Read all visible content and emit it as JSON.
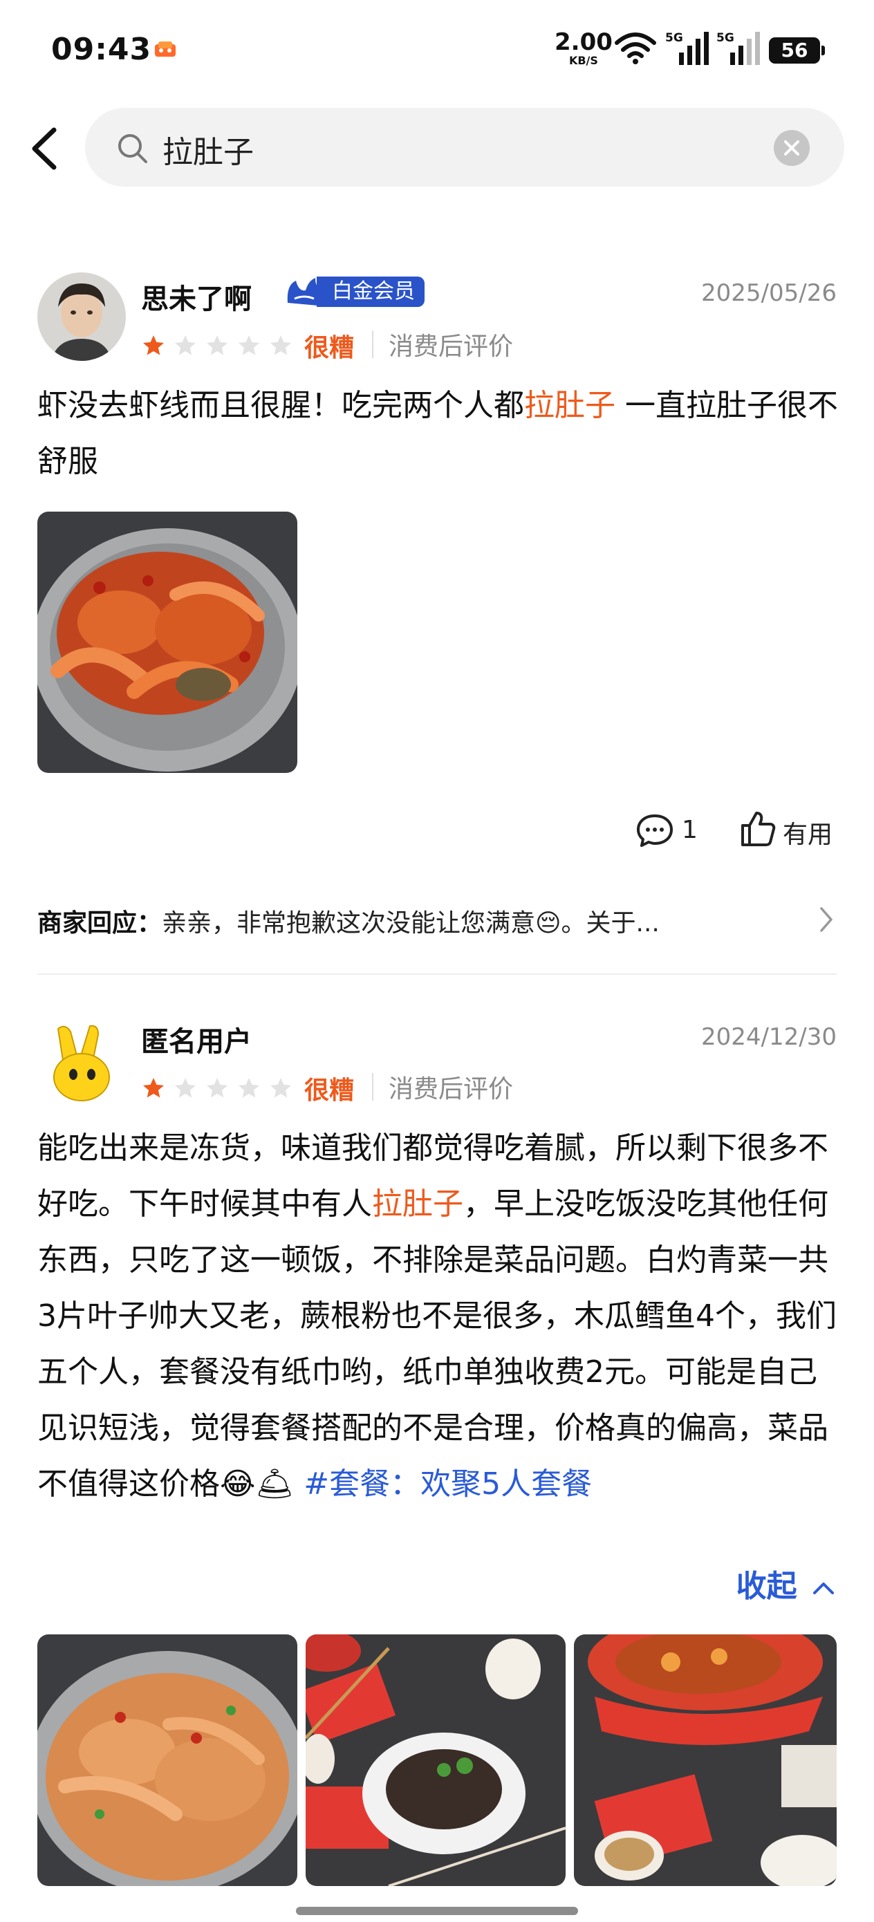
{
  "status_bar": {
    "time": "09:43",
    "net_speed": "2.00",
    "net_unit": "KB/S",
    "signal_1": "5G",
    "signal_2": "5G",
    "battery": "56",
    "icons": [
      "app-notification-icon",
      "wifi-icon",
      "cellular-signal-icon",
      "cellular-signal-icon",
      "battery-icon"
    ]
  },
  "search": {
    "query": "拉肚子",
    "icons": [
      "back-arrow-icon",
      "search-icon",
      "clear-icon"
    ]
  },
  "reviews": [
    {
      "username": "思未了啊",
      "badge": "白金会员",
      "date": "2025/05/26",
      "stars": 1,
      "max_stars": 5,
      "rating_label": "很糟",
      "review_type": "消费后评价",
      "content_segments": [
        {
          "text": "虾没去虾线而且很腥！吃完两个人都",
          "highlight": false
        },
        {
          "text": "拉肚子",
          "highlight": true
        },
        {
          "text": " 一直拉肚子很不舒服",
          "highlight": false
        }
      ],
      "photos": [
        "crayfish-crab-seafood-pot"
      ],
      "comment_count": "1",
      "useful_label": "有用",
      "merchant_reply_label": "商家回应：",
      "merchant_reply_text": "亲亲，非常抱歉这次没能让您满意😔。关于..."
    },
    {
      "username": "匿名用户",
      "date": "2024/12/30",
      "stars": 1,
      "max_stars": 5,
      "rating_label": "很糟",
      "review_type": "消费后评价",
      "content_segments": [
        {
          "text": "能吃出来是冻货，味道我们都觉得吃着腻，所以剩下很多不好吃。下午时候其中有人",
          "highlight": false
        },
        {
          "text": "拉肚子",
          "highlight": true
        },
        {
          "text": "，早上没吃饭没吃其他任何东西，只吃了这一顿饭，不排除是菜品问题。白灼青菜一共3片叶子帅大又老，蕨根粉也不是很多，木瓜鳕鱼4个，我们五个人，套餐没有纸巾哟，纸巾单独收费2元。可能是自己见识短浅，觉得套餐搭配的不是合理，价格真的偏高，菜品不值得这价格😂🛎",
          "highlight": false
        }
      ],
      "tag_link": "#套餐：欢聚5人套餐",
      "collapse_label": "收起",
      "photos": [
        "chicken-feet-pot",
        "fern-noodles-table",
        "red-pot-table"
      ]
    }
  ],
  "colors": {
    "accent_orange": "#ee5a1c",
    "link_blue": "#2a5bd7",
    "badge_blue": "#2a53c9",
    "muted_gray": "#8a8a8a"
  }
}
